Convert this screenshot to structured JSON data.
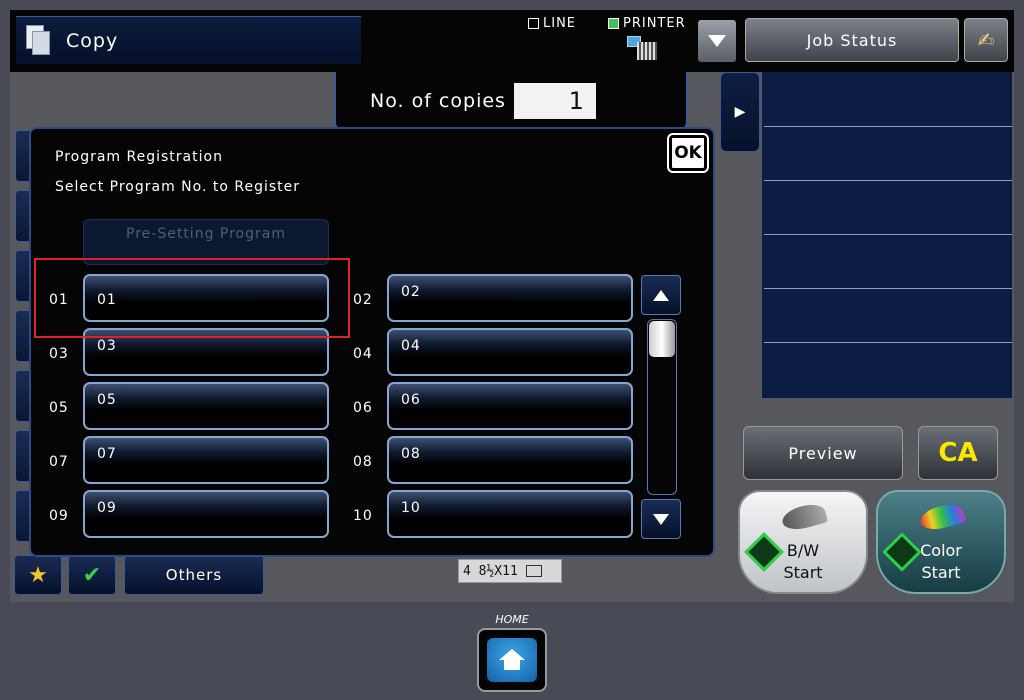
{
  "header": {
    "mode_label": "Copy",
    "line_label": "LINE",
    "printer_label": "PRINTER",
    "job_status_label": "Job Status",
    "help_glyph": "✍"
  },
  "copies": {
    "label": "No. of copies",
    "value": "1"
  },
  "dialog": {
    "title": "Program Registration",
    "subtitle": "Select Program No. to Register",
    "ok_label": "OK",
    "presetting_label": "Pre-Setting Program",
    "slots": [
      {
        "num": "01",
        "name": "01"
      },
      {
        "num": "02",
        "name": "02"
      },
      {
        "num": "03",
        "name": "03"
      },
      {
        "num": "04",
        "name": "04"
      },
      {
        "num": "05",
        "name": "05"
      },
      {
        "num": "06",
        "name": "06"
      },
      {
        "num": "07",
        "name": "07"
      },
      {
        "num": "08",
        "name": "08"
      },
      {
        "num": "09",
        "name": "09"
      },
      {
        "num": "10",
        "name": "10"
      }
    ]
  },
  "right_panel": {
    "preview_label": "Preview",
    "ca_label": "CA",
    "bw_start": {
      "line1": "B/W",
      "line2": "Start"
    },
    "color_start": {
      "line1": "Color",
      "line2": "Start"
    }
  },
  "bottom": {
    "others_label": "Others",
    "paper_text": "4 8½X11"
  },
  "home_label": "HOME",
  "colors": {
    "highlight": "#e0202a",
    "accent_blue": "#2e4a85",
    "ca_yellow": "#ffe600",
    "start_green": "#2fcf4a"
  },
  "icons": [
    "copy-doc-icon",
    "printer-icon",
    "dropdown-arrow-icon",
    "help-icon",
    "favorite-star-icon",
    "checkmark-icon",
    "home-icon",
    "scroll-up-icon",
    "scroll-down-icon",
    "expand-panel-icon"
  ]
}
